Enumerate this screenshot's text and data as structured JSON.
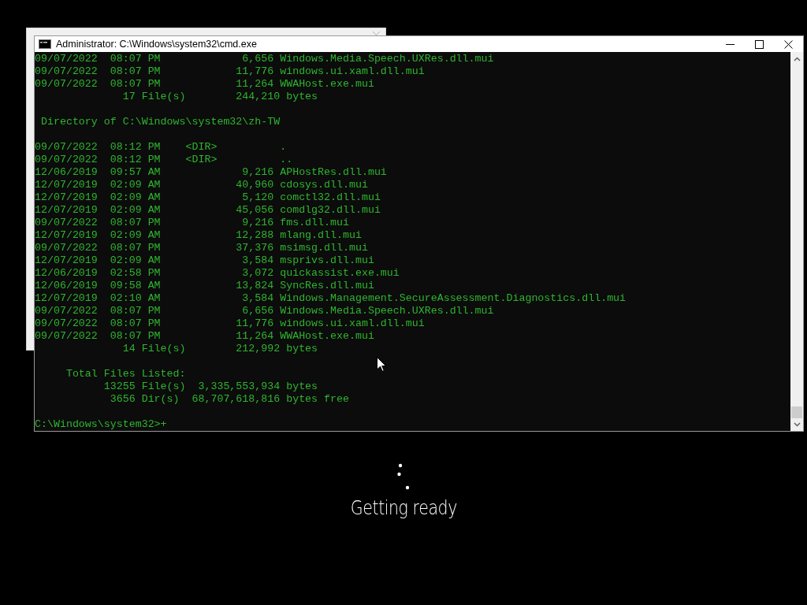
{
  "console_window": {
    "title": "Administrator: C:\\Windows\\system32\\cmd.exe",
    "lines": [
      {
        "kind": "text",
        "text": "09/07/2022  08:07 PM             6,656 Windows.Media.Speech.UXRes.dll.mui"
      },
      {
        "kind": "text",
        "text": "09/07/2022  08:07 PM            11,776 windows.ui.xaml.dll.mui"
      },
      {
        "kind": "text",
        "text": "09/07/2022  08:07 PM            11,264 WWAHost.exe.mui"
      },
      {
        "kind": "text",
        "text": "              17 File(s)        244,210 bytes"
      },
      {
        "kind": "blank"
      },
      {
        "kind": "text",
        "text": " Directory of C:\\Windows\\system32\\zh-TW"
      },
      {
        "kind": "blank"
      },
      {
        "kind": "text",
        "text": "09/07/2022  08:12 PM    <DIR>          ."
      },
      {
        "kind": "text",
        "text": "09/07/2022  08:12 PM    <DIR>          .."
      },
      {
        "kind": "text",
        "text": "12/06/2019  09:57 AM             9,216 APHostRes.dll.mui"
      },
      {
        "kind": "text",
        "text": "12/07/2019  02:09 AM            40,960 cdosys.dll.mui"
      },
      {
        "kind": "text",
        "text": "12/07/2019  02:09 AM             5,120 comctl32.dll.mui"
      },
      {
        "kind": "text",
        "text": "12/07/2019  02:09 AM            45,056 comdlg32.dll.mui"
      },
      {
        "kind": "text",
        "text": "09/07/2022  08:07 PM             9,216 fms.dll.mui"
      },
      {
        "kind": "text",
        "text": "12/07/2019  02:09 AM            12,288 mlang.dll.mui"
      },
      {
        "kind": "text",
        "text": "09/07/2022  08:07 PM            37,376 msimsg.dll.mui"
      },
      {
        "kind": "text",
        "text": "12/07/2019  02:09 AM             3,584 msprivs.dll.mui"
      },
      {
        "kind": "text",
        "text": "12/06/2019  02:58 PM             3,072 quickassist.exe.mui"
      },
      {
        "kind": "text",
        "text": "12/06/2019  09:58 AM            13,824 SyncRes.dll.mui"
      },
      {
        "kind": "text",
        "text": "12/07/2019  02:10 AM             3,584 Windows.Management.SecureAssessment.Diagnostics.dll.mui"
      },
      {
        "kind": "text",
        "text": "09/07/2022  08:07 PM             6,656 Windows.Media.Speech.UXRes.dll.mui"
      },
      {
        "kind": "text",
        "text": "09/07/2022  08:07 PM            11,776 windows.ui.xaml.dll.mui"
      },
      {
        "kind": "text",
        "text": "09/07/2022  08:07 PM            11,264 WWAHost.exe.mui"
      },
      {
        "kind": "text",
        "text": "              14 File(s)        212,992 bytes"
      },
      {
        "kind": "blank"
      },
      {
        "kind": "text",
        "text": "     Total Files Listed:"
      },
      {
        "kind": "text",
        "text": "           13255 File(s)  3,335,553,934 bytes"
      },
      {
        "kind": "text",
        "text": "            3656 Dir(s)  68,707,618,816 bytes free"
      },
      {
        "kind": "blank"
      },
      {
        "kind": "prompt",
        "text": "C:\\Windows\\system32>+"
      }
    ]
  },
  "setup_status": {
    "message": "Getting ready"
  }
}
